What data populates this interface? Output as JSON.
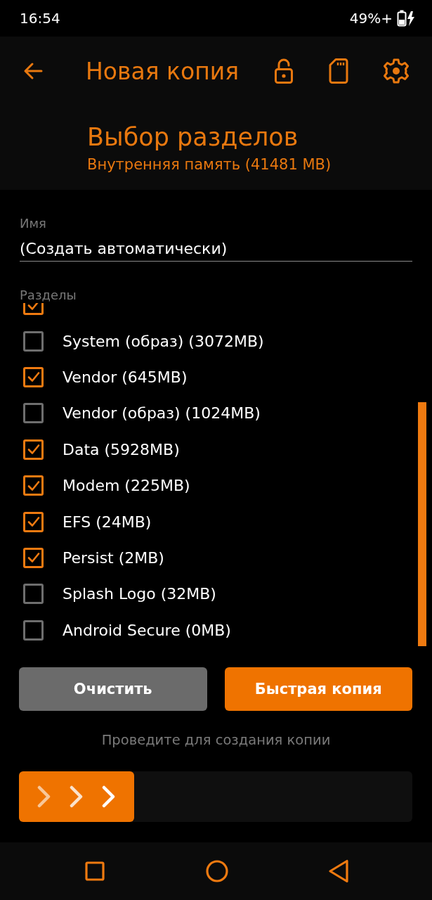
{
  "status_bar": {
    "time": "16:54",
    "battery": "49%+"
  },
  "app_bar": {
    "title": "Новая копия"
  },
  "header": {
    "title": "Выбор разделов",
    "subtitle": "Внутренняя память (41481 MB)"
  },
  "name_field": {
    "label": "Имя",
    "value": "(Создать автоматически)"
  },
  "partitions": {
    "label": "Разделы",
    "items": [
      {
        "checked": true
      },
      {
        "name": "System (образ) (3072MB)",
        "checked": false
      },
      {
        "name": "Vendor (645MB)",
        "checked": true
      },
      {
        "name": "Vendor (образ) (1024MB)",
        "checked": false
      },
      {
        "name": "Data (5928MB)",
        "checked": true
      },
      {
        "name": "Modem (225MB)",
        "checked": true
      },
      {
        "name": "EFS (24MB)",
        "checked": true
      },
      {
        "name": "Persist (2MB)",
        "checked": true
      },
      {
        "name": "Splash Logo (32MB)",
        "checked": false
      },
      {
        "name": "Android Secure (0MB)",
        "checked": false
      }
    ]
  },
  "buttons": [
    {
      "label": "Очистить",
      "kind": "secondary"
    },
    {
      "label": "Быстрая копия",
      "kind": "primary"
    }
  ],
  "swipe": {
    "hint": "Проведите для создания копии"
  }
}
